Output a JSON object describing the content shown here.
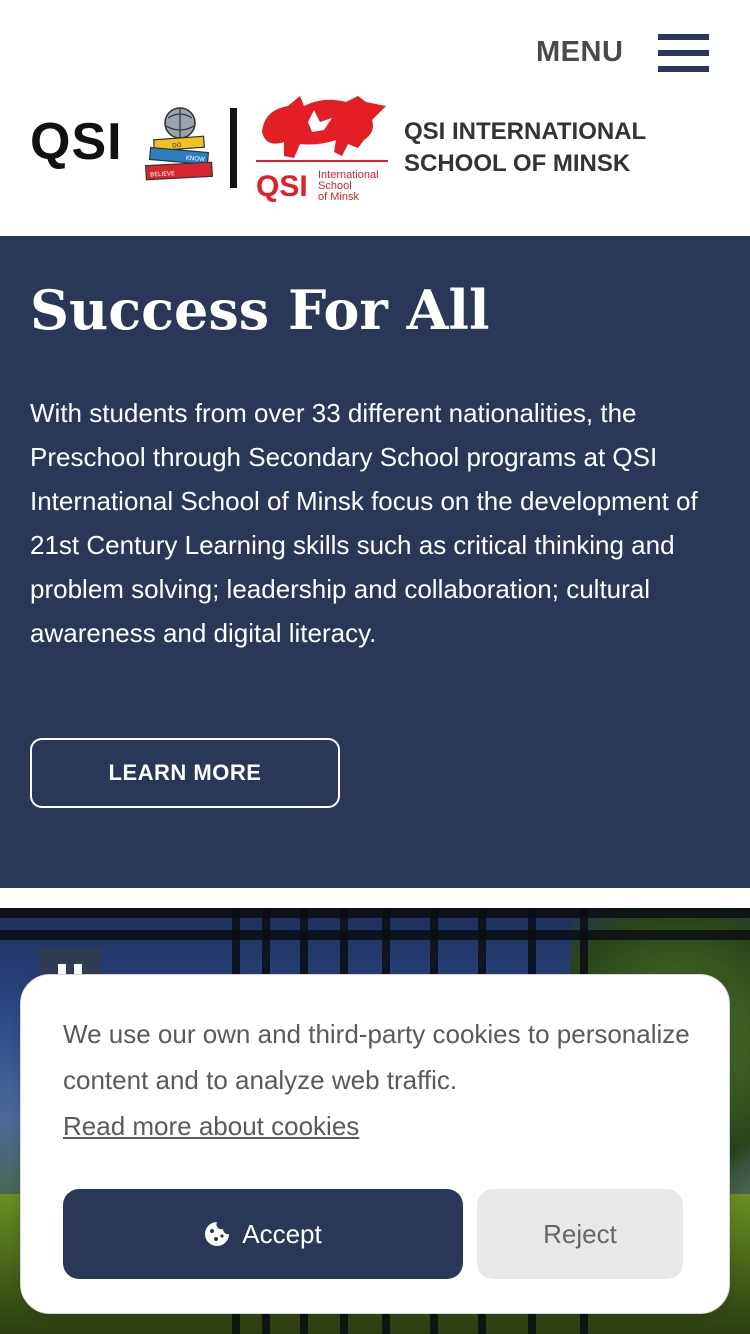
{
  "header": {
    "menu_label": "MENU",
    "qsi_text": "QSI",
    "books_icon": "do-know-believe-books-icon",
    "books_words": [
      "DO",
      "KNOW",
      "BELIEVE"
    ],
    "minsk_logo_icon": "qsi-minsk-bison-logo",
    "minsk_logo_qsi": "QSI",
    "minsk_logo_sub": [
      "International",
      "School",
      "of Minsk"
    ],
    "school_name_line1": "QSI INTERNATIONAL",
    "school_name_line2": "SCHOOL OF MINSK",
    "hamburger_icon": "hamburger-menu-icon"
  },
  "hero": {
    "title": "Success For All",
    "body": "With students from over 33 different nationalities, the Preschool through Secondary School programs at QSI International School of Minsk focus on the development of 21st Century Learning skills such as critical thinking and problem solving; leadership and collaboration; cultural awareness and digital literacy.",
    "button_label": "LEARN MORE"
  },
  "media": {
    "pause_icon": "pause-icon"
  },
  "cookie_banner": {
    "text": "We use our own and third-party cookies to personalize content and to analyze web traffic.",
    "link_label": "Read more about cookies",
    "accept_label": "Accept",
    "reject_label": "Reject",
    "accept_icon": "cookie-icon"
  },
  "colors": {
    "navy": "#2a3759",
    "logo_red": "#e31e24"
  }
}
